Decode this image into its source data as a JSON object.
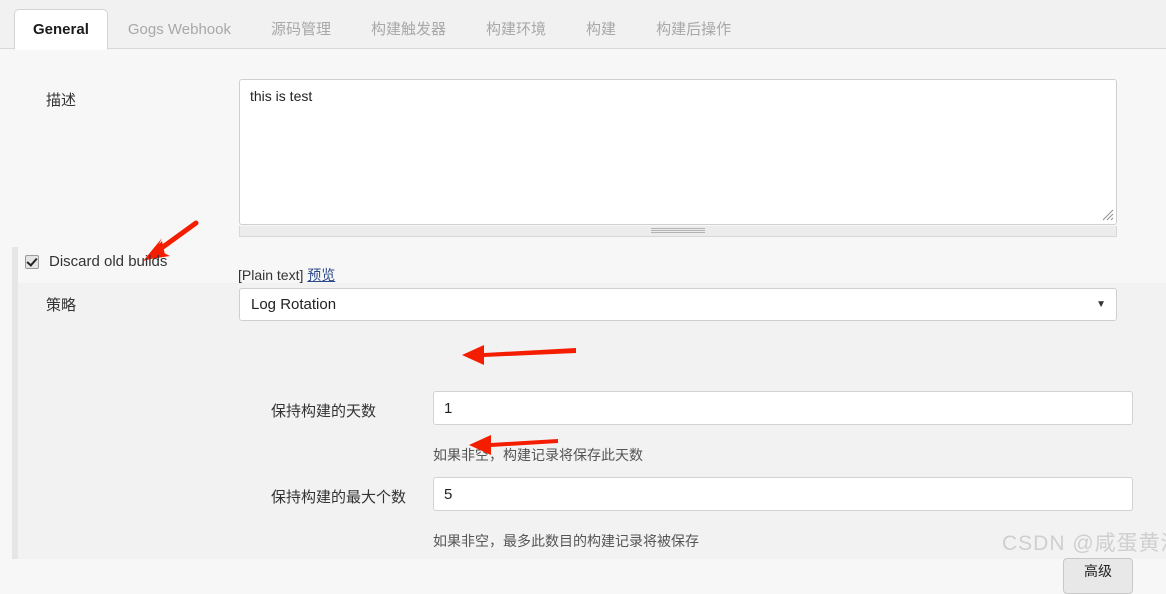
{
  "tabs": [
    {
      "label": "General",
      "active": true
    },
    {
      "label": "Gogs Webhook",
      "active": false
    },
    {
      "label": "源码管理",
      "active": false
    },
    {
      "label": "构建触发器",
      "active": false
    },
    {
      "label": "构建环境",
      "active": false
    },
    {
      "label": "构建",
      "active": false
    },
    {
      "label": "构建后操作",
      "active": false
    }
  ],
  "description": {
    "label": "描述",
    "value": "this is test",
    "placeholder": "",
    "markup_note": "[Plain text]",
    "preview_link": "预览"
  },
  "help_icon": "?",
  "discard": {
    "checkbox_label": "Discard old builds",
    "checked": true,
    "strategy_label": "策略",
    "strategy_value": "Log Rotation",
    "caret": "▼",
    "fields": [
      {
        "label": "保持构建的天数",
        "value": "1",
        "help": "如果非空，构建记录将保存此天数"
      },
      {
        "label": "保持构建的最大个数",
        "value": "5",
        "help": "如果非空，最多此数目的构建记录将被保存"
      }
    ]
  },
  "advanced_button": "高级",
  "watermark": "CSDN @咸蛋黄派",
  "colors": {
    "accent_red": "#f51d00",
    "link": "#2b4a8b",
    "page_bg": "#f7f7f7",
    "panel_bg": "#f2f2f2"
  }
}
